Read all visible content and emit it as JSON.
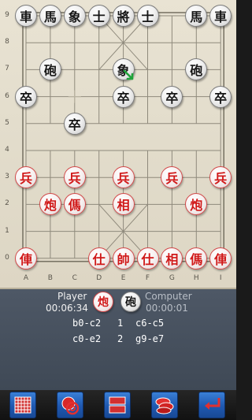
{
  "board": {
    "rank_labels": [
      "9",
      "8",
      "7",
      "6",
      "5",
      "4",
      "3",
      "2",
      "1",
      "0"
    ],
    "file_labels": [
      "A",
      "B",
      "C",
      "D",
      "E",
      "F",
      "G",
      "H",
      "I"
    ],
    "last_move_marker": "green-arrow-icon",
    "pieces_black": [
      {
        "char": "車",
        "name": "black-chariot-a9"
      },
      {
        "char": "馬",
        "name": "black-horse-b9"
      },
      {
        "char": "象",
        "name": "black-elephant-c9"
      },
      {
        "char": "士",
        "name": "black-advisor-d9"
      },
      {
        "char": "將",
        "name": "black-general-e9"
      },
      {
        "char": "士",
        "name": "black-advisor-f9"
      },
      {
        "char": "馬",
        "name": "black-horse-h9"
      },
      {
        "char": "車",
        "name": "black-chariot-i9"
      },
      {
        "char": "砲",
        "name": "black-cannon-b7"
      },
      {
        "char": "象",
        "name": "black-elephant-e7"
      },
      {
        "char": "砲",
        "name": "black-cannon-h7"
      },
      {
        "char": "卒",
        "name": "black-soldier-a6"
      },
      {
        "char": "卒",
        "name": "black-soldier-e6"
      },
      {
        "char": "卒",
        "name": "black-soldier-g6"
      },
      {
        "char": "卒",
        "name": "black-soldier-i6"
      },
      {
        "char": "卒",
        "name": "black-soldier-c5"
      }
    ],
    "pieces_red": [
      {
        "char": "兵",
        "name": "red-soldier-a3"
      },
      {
        "char": "兵",
        "name": "red-soldier-c3"
      },
      {
        "char": "兵",
        "name": "red-soldier-e3"
      },
      {
        "char": "兵",
        "name": "red-soldier-g3"
      },
      {
        "char": "兵",
        "name": "red-soldier-i3"
      },
      {
        "char": "炮",
        "name": "red-cannon-b2"
      },
      {
        "char": "傌",
        "name": "red-horse-c2"
      },
      {
        "char": "相",
        "name": "red-elephant-e2"
      },
      {
        "char": "炮",
        "name": "red-cannon-h2"
      },
      {
        "char": "俥",
        "name": "red-chariot-a0"
      },
      {
        "char": "仕",
        "name": "red-advisor-d0"
      },
      {
        "char": "帥",
        "name": "red-general-e0"
      },
      {
        "char": "仕",
        "name": "red-advisor-f0"
      },
      {
        "char": "相",
        "name": "red-elephant-g0"
      },
      {
        "char": "傌",
        "name": "red-horse-h0"
      },
      {
        "char": "俥",
        "name": "red-chariot-i0"
      }
    ]
  },
  "info": {
    "player_label": "Player",
    "player_time": "00:06:34",
    "player_piece": "炮",
    "computer_piece": "砲",
    "computer_label": "Computer",
    "computer_time": "00:00:01",
    "moves": [
      {
        "num": "1",
        "player": "b0-c2",
        "computer": "c6-c5"
      },
      {
        "num": "2",
        "player": "c0-e2",
        "computer": "g9-e7"
      }
    ]
  },
  "toolbar": {
    "buttons": [
      "new-game-grid-icon",
      "stop-target-icon",
      "board-split-icon",
      "pieces-stack-icon",
      "undo-arrow-icon"
    ]
  },
  "colors": {
    "red_piece": "#d01818",
    "black_piece": "#161616",
    "panel": "#4e5866",
    "button": "#2a6fcf"
  }
}
